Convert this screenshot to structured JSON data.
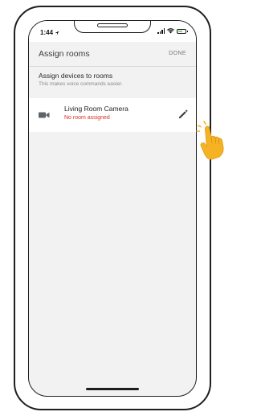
{
  "status_bar": {
    "time": "1:44",
    "location_arrow": "location-arrow-icon",
    "icons": [
      "signal-icon",
      "wifi-icon",
      "battery-icon"
    ]
  },
  "app_bar": {
    "title": "Assign rooms",
    "done_label": "DONE"
  },
  "section": {
    "title": "Assign devices to rooms",
    "subtitle": "This makes voice commands easier."
  },
  "devices": [
    {
      "icon": "video-camera-icon",
      "name": "Living Room Camera",
      "status": "No room assigned",
      "action_icon": "pencil-edit-icon"
    }
  ],
  "colors": {
    "screen_background": "#f2f2f2",
    "card_background": "#ffffff",
    "error_red": "#d93025",
    "muted_text": "#777777",
    "hand_yellow": "#f5b324",
    "tap_ripple": "#f5b324"
  },
  "overlay": {
    "icon": "tap-hand-icon"
  }
}
